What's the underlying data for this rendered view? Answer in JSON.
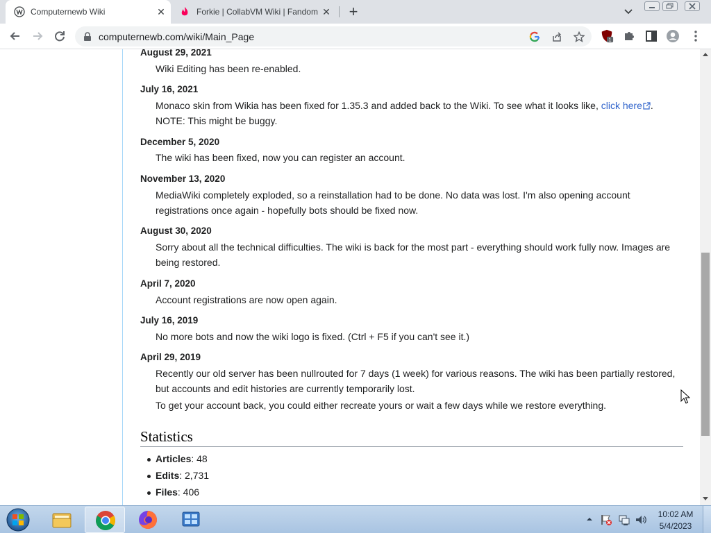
{
  "browser": {
    "tabs": [
      {
        "title": "Computernewb Wiki",
        "active": true
      },
      {
        "title": "Forkie | CollabVM Wiki | Fandom",
        "active": false
      }
    ],
    "url": "computernewb.com/wiki/Main_Page",
    "extension_badge": "1"
  },
  "news": [
    {
      "date": "August 29, 2021",
      "lines": [
        {
          "text": "Wiki Editing has been re-enabled."
        }
      ]
    },
    {
      "date": "July 16, 2021",
      "lines": [
        {
          "text": "Monaco skin from Wikia has been fixed for 1.35.3 and added back to the Wiki. To see what it looks like, ",
          "link": "click here",
          "after": "."
        },
        {
          "text": "NOTE: This might be buggy."
        }
      ]
    },
    {
      "date": "December 5, 2020",
      "lines": [
        {
          "text": "The wiki has been fixed, now you can register an account."
        }
      ]
    },
    {
      "date": "November 13, 2020",
      "lines": [
        {
          "text": "MediaWiki completely exploded, so a reinstallation had to be done. No data was lost. I'm also opening account"
        },
        {
          "text": "registrations once again - hopefully bots should be fixed now."
        }
      ]
    },
    {
      "date": "August 30, 2020",
      "lines": [
        {
          "text": "Sorry about all the technical difficulties. The wiki is back for the most part - everything should work fully now. Images are"
        },
        {
          "text": "being restored."
        }
      ]
    },
    {
      "date": "April 7, 2020",
      "lines": [
        {
          "text": "Account registrations are now open again."
        }
      ]
    },
    {
      "date": "July 16, 2019",
      "lines": [
        {
          "text": "No more bots and now the wiki logo is fixed. (Ctrl + F5 if you can't see it.)"
        }
      ]
    },
    {
      "date": "April 29, 2019",
      "lines": [
        {
          "text": "Recently our old server has been nullrouted for 7 days (1 week) for various reasons. The wiki has been partially restored,"
        },
        {
          "text": "but accounts and edit histories are currently temporarily lost."
        },
        {
          "text": "To get your account back, you could either recreate yours or wait a few days while we restore everything."
        }
      ]
    }
  ],
  "statistics": {
    "heading": "Statistics",
    "items": [
      {
        "label": "Articles",
        "value": ": 48"
      },
      {
        "label": "Edits",
        "value": ": 2,731"
      },
      {
        "label": "Files",
        "value": ": 406"
      }
    ]
  },
  "taskbar": {
    "time": "10:02 AM",
    "date": "5/4/2023"
  },
  "icons": {
    "tab1": "wiki-favicon-icon",
    "tab2": "fandom-favicon-icon",
    "back": "arrow-left-icon",
    "forward": "arrow-right-icon",
    "reload": "reload-icon",
    "lock": "lock-icon",
    "google": "google-icon",
    "share": "share-icon",
    "bookmark": "star-icon",
    "extensions": "puzzle-icon",
    "sidepanel": "side-panel-icon",
    "profile": "profile-icon",
    "menu": "kebab-menu-icon"
  },
  "colors": {
    "link": "#3366cc",
    "tabstrip": "#dee1e6",
    "taskbar": "#b5cde6"
  }
}
